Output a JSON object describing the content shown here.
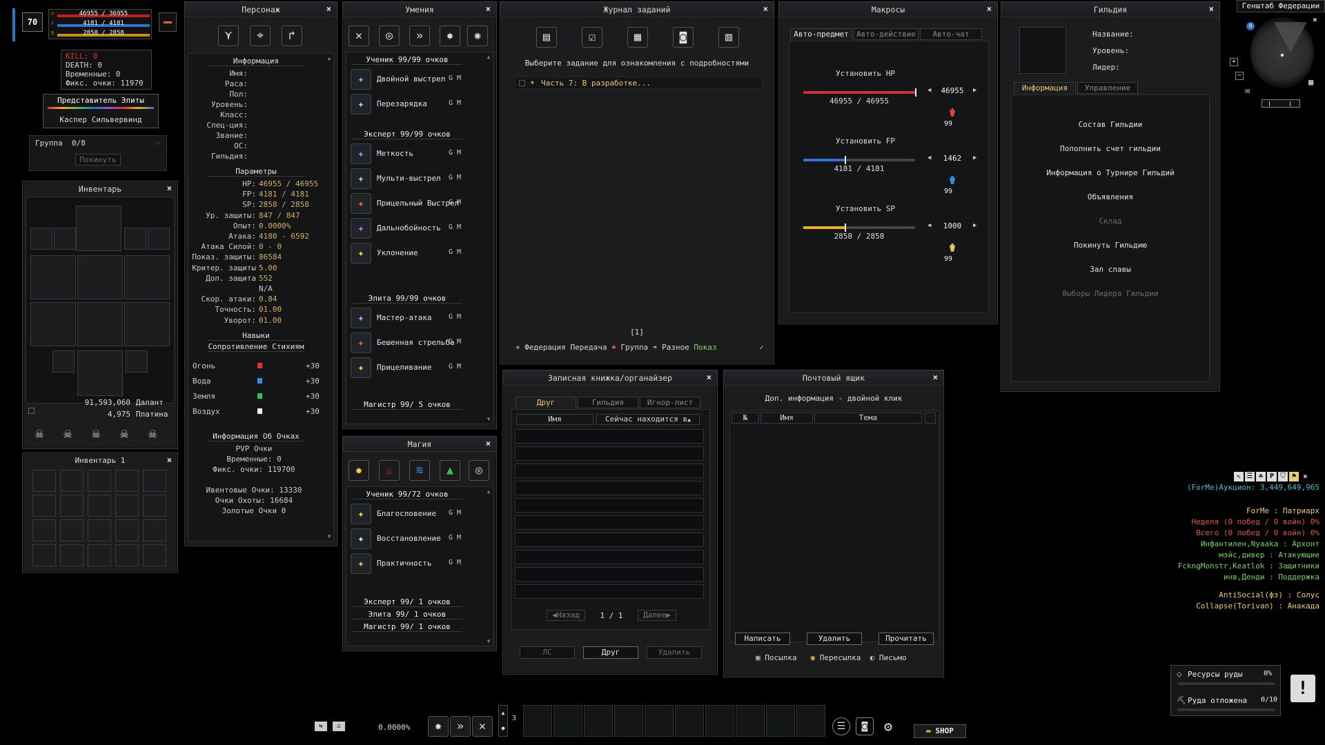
{
  "player": {
    "level": "70",
    "hp": "46955 / 36955",
    "fp": "4181 / 4181",
    "sp": "2858 / 2858"
  },
  "pk": {
    "kill": "KILL: 0",
    "death": "DEATH: 0",
    "temp": "Временные: 0",
    "fix": "Фикс. очки: 11970"
  },
  "elite": {
    "title": "Представитель Элиты",
    "name": "Каспер Сильвервинд"
  },
  "group": {
    "label": "Группа  0/8",
    "leave": "Покинуть"
  },
  "character": {
    "title": "Персонаж",
    "info_header": "Информация",
    "info_labels": [
      "Имя:",
      "Раса:",
      "Пол:",
      "Уровень:",
      "Класс:",
      "Спец-ция:",
      "Звание:",
      "ОС:",
      "Гильдия:"
    ],
    "params_header": "Параметры",
    "params": [
      [
        "HP:",
        "46955 / 46955"
      ],
      [
        "FP:",
        "4181 / 4181"
      ],
      [
        "SP:",
        "2858 / 2858"
      ],
      [
        "Ур. защиты:",
        "847 / 847"
      ],
      [
        "Опыт:",
        "0.0000%"
      ],
      [
        "Атака:",
        "4180 - 6592"
      ],
      [
        "Атака Силой:",
        "0 - 0"
      ],
      [
        "Показ. защиты:",
        "86584"
      ],
      [
        "Критер. защиты",
        "5.00"
      ],
      [
        "Доп. защита",
        "552"
      ],
      [
        "",
        "N/A"
      ],
      [
        "Скор. атаки:",
        "0.84"
      ],
      [
        "Точность:",
        "01.00"
      ],
      [
        "Уворот:",
        "01.00"
      ]
    ],
    "skills_header": "Навыки",
    "resist_header": "Сопротивление Стихиям",
    "resists": [
      {
        "name": "Огонь",
        "value": "+30"
      },
      {
        "name": "Вода",
        "value": "+30"
      },
      {
        "name": "Земля",
        "value": "+30"
      },
      {
        "name": "Воздух",
        "value": "+30"
      }
    ],
    "points_header": "Информация Об Очках",
    "points": [
      "PVP Очки",
      "Временные: 0",
      "Фикс. очки: 119700",
      "",
      "Ивентовые Очки: 13330",
      "Очки Охоты: 16684",
      "Золотые Очки 0"
    ]
  },
  "skills": {
    "title": "Умения",
    "tiers": [
      "Ученик 99/99 очков",
      "Эксперт 99/99 очков",
      "Элита 99/99 очков",
      "Магистр 99/ 5 очков"
    ],
    "list1": [
      "Двойной выстрел",
      "Перезарядка"
    ],
    "list2": [
      "Меткость",
      "Мульти-выстрел",
      "Прицельный Выстрел",
      "Дальнобойность",
      "Уклонение"
    ],
    "list3": [
      "Мастер-атака",
      "Бешенная стрельба",
      "Прицеливание"
    ],
    "gm": "G M"
  },
  "magic": {
    "title": "Магия",
    "tier_top": "Ученик 99/72 очков",
    "list": [
      "Благословение",
      "Восстановление",
      "Практичность"
    ],
    "tiers": [
      "Эксперт 99/ 1 очков",
      "Элита 99/ 1 очков",
      "Магистр 99/ 1 очков"
    ],
    "gm": "G M"
  },
  "inventory": {
    "title": "Инвентарь",
    "money1": "91,593,060",
    "cur1": "Далант",
    "money2": "4,975",
    "cur2": "Платина"
  },
  "inventory1": {
    "title": "Инвентарь 1"
  },
  "quests": {
    "title": "Журнал заданий",
    "hint": "Выберите задание для ознакомления с подробностями",
    "entry": "Часть 7: В разработке...",
    "page": "[1]",
    "filters": [
      "Федерация",
      "Передача",
      "Группа",
      "Разное",
      "Показ"
    ]
  },
  "notebook": {
    "title": "Записная книжка/органайзер",
    "tabs": [
      "Друг",
      "Гильдия",
      "Игнор-лист"
    ],
    "col1": "Имя",
    "col2": "Сейчас находится в",
    "prev": "Назад",
    "page": "1 / 1",
    "next": "Далее",
    "b1": "ЛС",
    "b2": "Друг",
    "b3": "Удалить"
  },
  "mail": {
    "title": "Почтовый ящик",
    "hint": "Доп. информация - двойной клик",
    "cols": [
      "№",
      "Имя",
      "Тема"
    ],
    "b1": "Написать",
    "b2": "Удалить",
    "b3": "Прочитать",
    "f1": "Посылка",
    "f2": "Пересылка",
    "f3": "Письмо"
  },
  "macros": {
    "title": "Макросы",
    "tabs": [
      "Авто-предмет",
      "Авто-действие",
      "Авто-чат"
    ],
    "hp_label": "Установить HP",
    "hp_val": "46955 / 46955",
    "hp_set": "46955",
    "fp_label": "Установить FP",
    "fp_val": "4181 / 4181",
    "fp_set": "1462",
    "sp_label": "Установить SP",
    "sp_val": "2858 / 2858",
    "sp_set": "1000",
    "potion_count": "99",
    "hp_fill": 1.0,
    "fp_fill": 0.37,
    "sp_fill": 0.37
  },
  "guild": {
    "title": "Гильдия",
    "name": "Название:",
    "level": "Уровень:",
    "leader": "Лидер:",
    "tabs": [
      "Информация",
      "Управление"
    ],
    "items": [
      "Состав Гильдии",
      "Пополнить счет гильдии",
      "Информация о Турнире Гильдий",
      "Объявления",
      "Склад",
      "Покинуть Гильдию",
      "Зал славы",
      "Выборы Лидера Гильдии"
    ],
    "disabled": [
      4,
      7
    ]
  },
  "minimap": {
    "title": "Генштаб Федерации",
    "badge": "0"
  },
  "chat": {
    "lines": [
      {
        "text": "(ForMe)Аукцион: 3,449,649,965",
        "color": "#3fc0d0"
      },
      {
        "text": "ForMe : Патриарх",
        "color": "#f0d060"
      },
      {
        "text": "Неделя (0 побед / 0 войн) 0%",
        "color": "#e05a3a"
      },
      {
        "text": "Всего (0 побед / 0 войн) 0%",
        "color": "#e05a3a"
      },
      {
        "text": "Инфантилен,Nyaaka : Архонт",
        "color": "#7ad060"
      },
      {
        "text": "мэйс,дивер : Атакующие",
        "color": "#7ad060"
      },
      {
        "text": "FckngMonstr,Keatlok : Защитники",
        "color": "#7ad060"
      },
      {
        "text": "инв,Денди : Поддержка",
        "color": "#7ad060"
      },
      {
        "text": "AntiSocial(фз) : Солус",
        "color": "#f0d060"
      },
      {
        "text": "Collapse(Torivan) : Анакада",
        "color": "#f0d060"
      }
    ]
  },
  "ore": {
    "line1": "Ресурсы руды",
    "pct": "0%",
    "line2": "Руда отложена",
    "cnt": "0/10"
  },
  "bottom": {
    "exp": "0.0000%",
    "slot_page": "3",
    "shop": "SHOP"
  },
  "colors": {
    "hp": "#e03030",
    "fp": "#2d74d0",
    "sp": "#e8b020",
    "gold": "#d4b15c"
  }
}
